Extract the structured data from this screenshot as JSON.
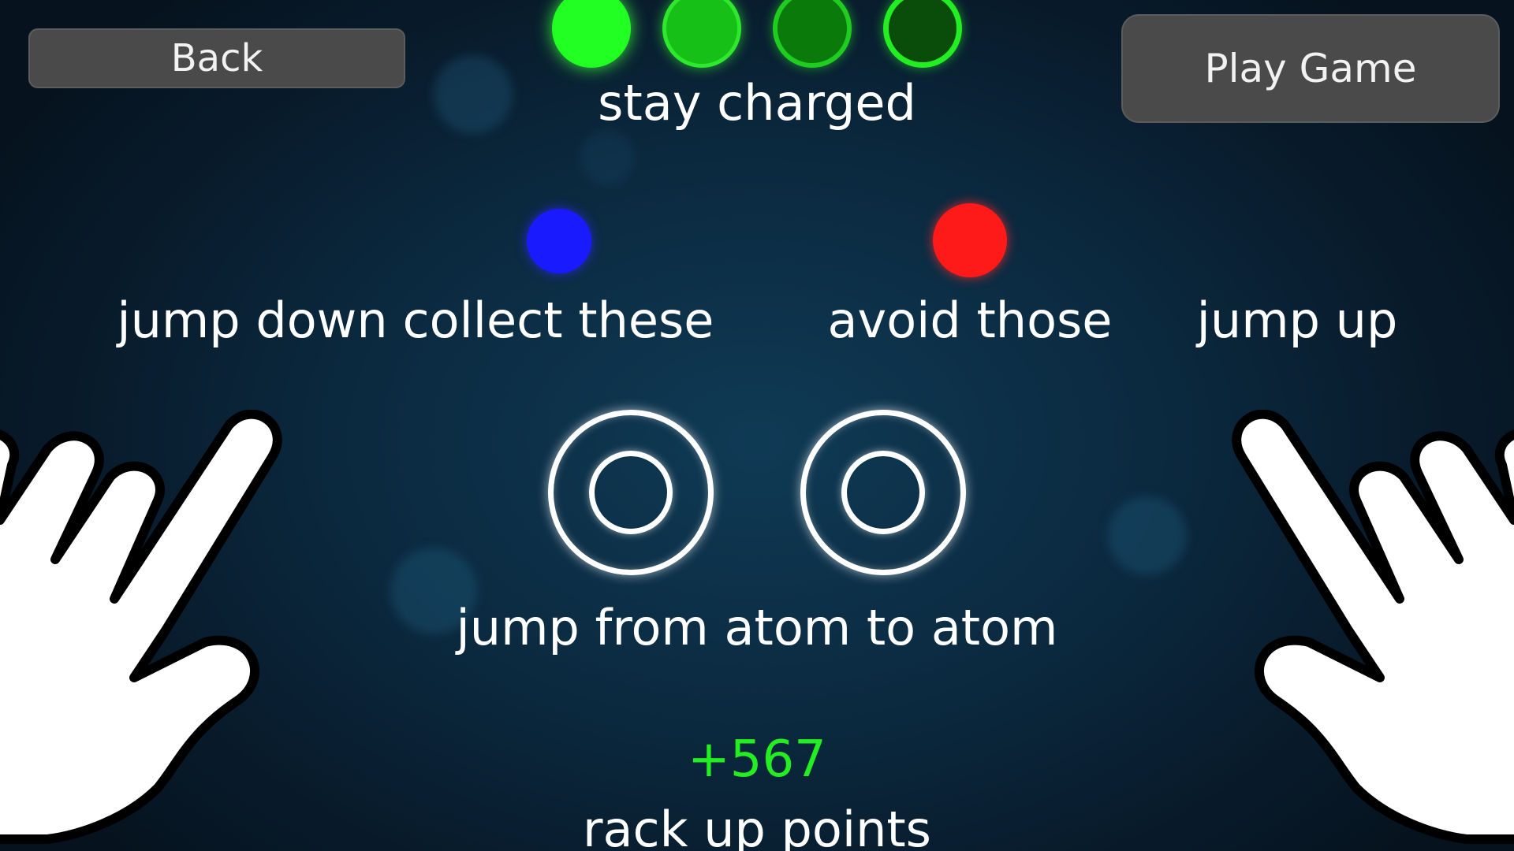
{
  "buttons": {
    "back": "Back",
    "play_game": "Play Game"
  },
  "charge": {
    "label": "stay charged",
    "indicators": [
      {
        "state": "full",
        "color": "#22ff22"
      },
      {
        "state": "medium",
        "color": "#18c418"
      },
      {
        "state": "low",
        "color": "#0b8a0b"
      },
      {
        "state": "empty",
        "color": "#0b5a0b"
      }
    ]
  },
  "instructions": {
    "jump_down": "jump down",
    "collect_these": "collect these",
    "avoid_those": "avoid those",
    "jump_up": "jump up",
    "jump_atoms": "jump from atom to atom",
    "rack_up_points": "rack up points"
  },
  "points": {
    "value": "+567"
  },
  "colors": {
    "collect_dot": "#1a1aff",
    "avoid_dot": "#ff1a1a",
    "points_text": "#22ee22",
    "button_bg": "#4a4a4a"
  },
  "icons": [
    "left-hand-icon",
    "right-hand-icon",
    "atom-icon"
  ]
}
